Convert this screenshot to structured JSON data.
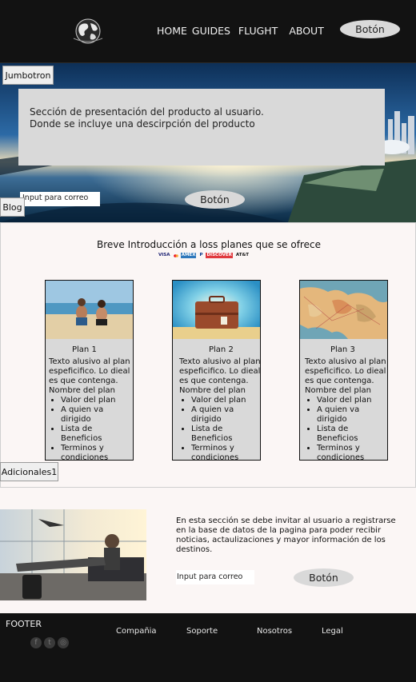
{
  "header": {
    "logo_icon": "globe-icon",
    "nav": [
      "HOME",
      "GUIDES",
      "FLUGHT",
      "ABOUT"
    ],
    "button_label": "Botón"
  },
  "hero": {
    "tag": "Jumbotron",
    "card_text_line1": "Sección de presentación del producto al usuario.",
    "card_text_line2": "Donde se incluye una descirpción del producto",
    "input_placeholder": "Input para correo",
    "button_label": "Botón",
    "blog_tag": "Blog"
  },
  "plans": {
    "intro": "Breve Introducción a loss planes que se ofrece",
    "payment_logos": [
      "VISA",
      "mastercard",
      "AMEX",
      "PayPal",
      "DISCOVER",
      "AT&T"
    ],
    "cards": [
      {
        "title": "Plan 1",
        "text": "Texto alusivo al plan espeficifico. Lo dieal es que contenga.",
        "list_title": "Nombre del plan",
        "items": [
          "Valor del plan",
          "A quien va dirigido",
          "Lista de Beneficios",
          "Terminos y condiciones"
        ]
      },
      {
        "title": "Plan 2",
        "text": "Texto alusivo al plan espeficifico. Lo dieal es que contenga.",
        "list_title": "Nombre del plan",
        "items": [
          "Valor del plan",
          "A quien va dirigido",
          "Lista de Beneficios",
          "Terminos y condiciones"
        ]
      },
      {
        "title": "Plan 3",
        "text": "Texto alusivo al plan espeficifico. Lo dieal es que contenga.",
        "list_title": "Nombre del plan",
        "items": [
          "Valor del plan",
          "A quien va dirigido",
          "Lista de Beneficios",
          "Terminos y condiciones"
        ]
      }
    ]
  },
  "additional": {
    "tag": "Adicionales1",
    "text": "En esta sección se debe invitar al usuario a registrarse en la base de datos de la pagina para poder recibir noticias, actaulizaciones y mayor información de los destinos.",
    "input_placeholder": "Input para correo",
    "button_label": "Botón"
  },
  "footer": {
    "title": "FOOTER",
    "social_icons": [
      "facebook-icon",
      "twitter-icon",
      "instagram-icon"
    ],
    "links": [
      "Compañia",
      "Soporte",
      "Nosotros",
      "Legal"
    ]
  },
  "colors": {
    "dark": "#121212",
    "panel_gray": "#d9d9d9",
    "section_bg": "#fbf6f5"
  }
}
